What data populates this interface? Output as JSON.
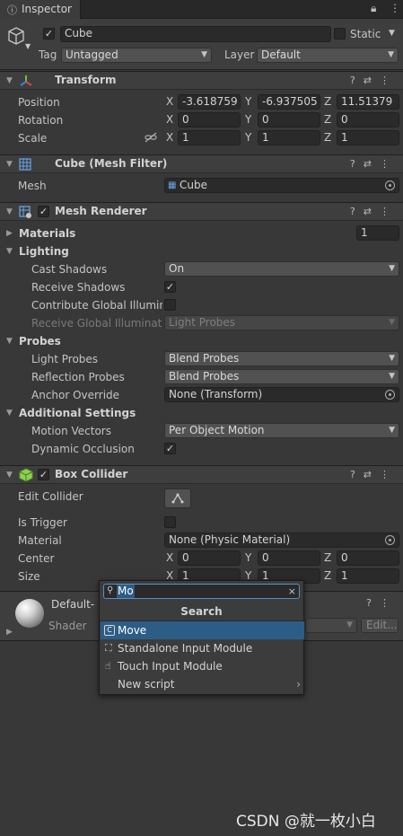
{
  "tab": {
    "title": "Inspector"
  },
  "object": {
    "name": "Cube",
    "active": true,
    "static_label": "Static",
    "tag_label": "Tag",
    "tag_value": "Untagged",
    "layer_label": "Layer",
    "layer_value": "Default"
  },
  "transform": {
    "title": "Transform",
    "position_label": "Position",
    "rotation_label": "Rotation",
    "scale_label": "Scale",
    "axes": {
      "x": "X",
      "y": "Y",
      "z": "Z"
    },
    "position": {
      "x": "-3.618759",
      "y": "-6.937505",
      "z": "11.51379"
    },
    "rotation": {
      "x": "0",
      "y": "0",
      "z": "0"
    },
    "scale": {
      "x": "1",
      "y": "1",
      "z": "1"
    }
  },
  "mesh_filter": {
    "title": "Cube (Mesh Filter)",
    "mesh_label": "Mesh",
    "mesh_value": "Cube"
  },
  "mesh_renderer": {
    "title": "Mesh Renderer",
    "materials_label": "Materials",
    "materials_count": "1",
    "lighting_label": "Lighting",
    "cast_shadows_label": "Cast Shadows",
    "cast_shadows_value": "On",
    "receive_shadows_label": "Receive Shadows",
    "contribute_gi_label": "Contribute Global Illuminat",
    "receive_gi_label": "Receive Global Illuminatio",
    "receive_gi_value": "Light Probes",
    "probes_label": "Probes",
    "light_probes_label": "Light Probes",
    "light_probes_value": "Blend Probes",
    "reflection_probes_label": "Reflection Probes",
    "reflection_probes_value": "Blend Probes",
    "anchor_override_label": "Anchor Override",
    "anchor_override_value": "None (Transform)",
    "additional_label": "Additional Settings",
    "motion_vectors_label": "Motion Vectors",
    "motion_vectors_value": "Per Object Motion",
    "dynamic_occlusion_label": "Dynamic Occlusion"
  },
  "box_collider": {
    "title": "Box Collider",
    "edit_collider_label": "Edit Collider",
    "is_trigger_label": "Is Trigger",
    "material_label": "Material",
    "material_value": "None (Physic Material)",
    "center_label": "Center",
    "center": {
      "x": "0",
      "y": "0",
      "z": "0"
    },
    "size_label": "Size",
    "size": {
      "x": "1",
      "y": "1",
      "z": "1"
    }
  },
  "material_section": {
    "title_partial": "Default-",
    "shader_label": "Shader",
    "edit_label": "Edit..."
  },
  "search_popup": {
    "query": "Mo",
    "header": "Search",
    "items": [
      {
        "label": "Move",
        "selected": true
      },
      {
        "label": "Standalone Input Module",
        "selected": false
      },
      {
        "label": "Touch Input Module",
        "selected": false
      },
      {
        "label": "New script",
        "selected": false
      }
    ]
  },
  "watermark": "CSDN @就一枚小白"
}
